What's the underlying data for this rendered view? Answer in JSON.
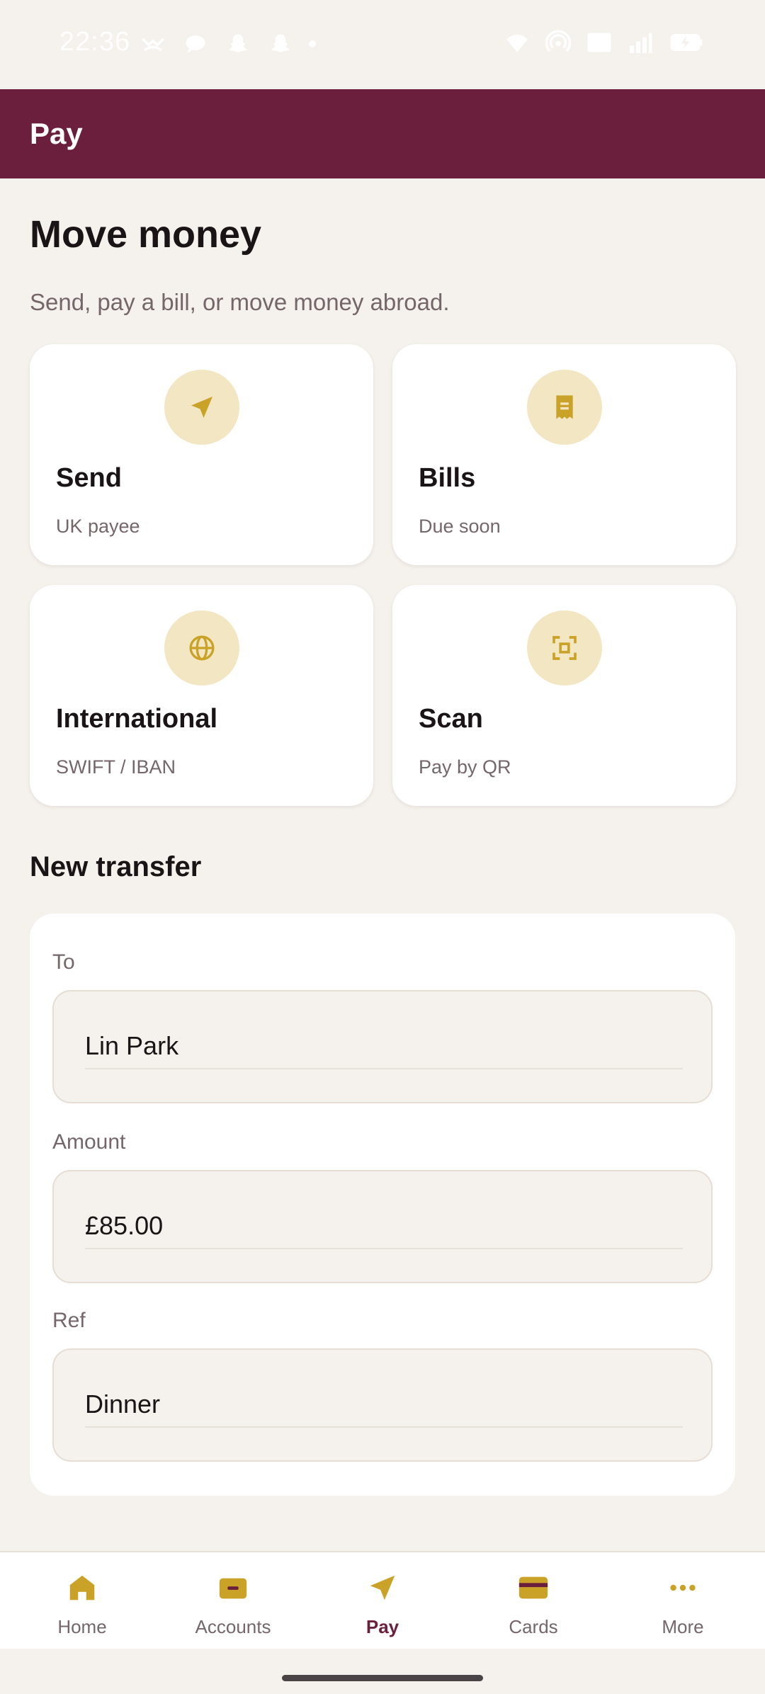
{
  "status": {
    "time": "22:36",
    "left_icons": [
      "missed-call-icon",
      "chat-icon",
      "snapchat-icon",
      "snapchat-icon",
      "dot-icon"
    ],
    "right_icons": [
      "wifi-icon",
      "hotspot-icon",
      "volte-icon",
      "signal-icon",
      "battery-charging-icon"
    ]
  },
  "appbar": {
    "title": "Pay"
  },
  "main": {
    "title": "Move money",
    "subtitle": "Send, pay a bill, or move money abroad.",
    "tiles": [
      {
        "title": "Send",
        "sub": "UK payee",
        "icon": "send-icon"
      },
      {
        "title": "Bills",
        "sub": "Due soon",
        "icon": "receipt-icon"
      },
      {
        "title": "International",
        "sub": "SWIFT / IBAN",
        "icon": "globe-icon"
      },
      {
        "title": "Scan",
        "sub": "Pay by QR",
        "icon": "qr-scan-icon"
      }
    ]
  },
  "transfer": {
    "title": "New transfer",
    "fields": [
      {
        "label": "To",
        "value": "Lin Park"
      },
      {
        "label": "Amount",
        "value": "£85.00"
      },
      {
        "label": "Ref",
        "value": "Dinner"
      }
    ]
  },
  "nav": {
    "items": [
      {
        "label": "Home",
        "icon": "home-icon"
      },
      {
        "label": "Accounts",
        "icon": "wallet-icon"
      },
      {
        "label": "Pay",
        "icon": "send-icon",
        "active": true
      },
      {
        "label": "Cards",
        "icon": "credit-card-icon"
      },
      {
        "label": "More",
        "icon": "more-horizontal-icon"
      }
    ]
  },
  "colors": {
    "brand": "#6b1f3d",
    "accent": "#c9a227",
    "accent_soft": "#f3e6c2",
    "background": "#f5f1ec"
  }
}
